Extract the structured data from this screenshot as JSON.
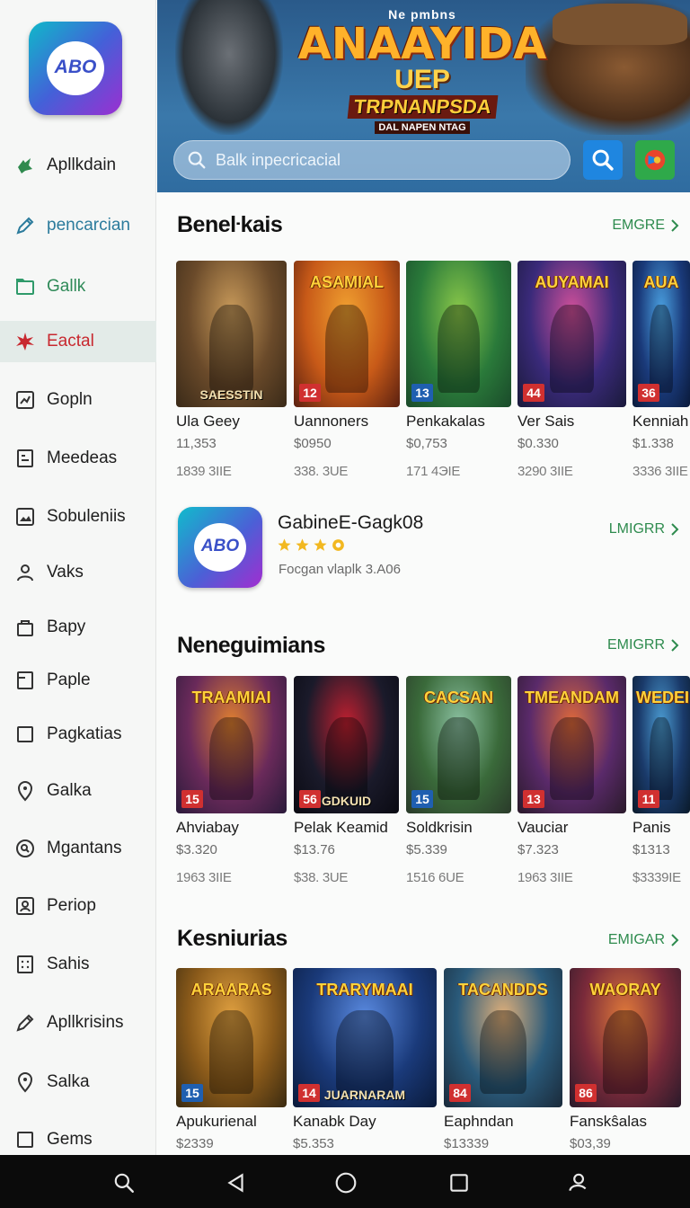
{
  "sidebar": {
    "logo_text": "ABO",
    "items": [
      {
        "label": "Apllkdain",
        "icon": "puzzle-icon",
        "style": "normal",
        "icon_color": "#2f8a4e"
      },
      {
        "label": "pencarcian",
        "icon": "pen-icon",
        "style": "teal",
        "icon_color": "#2b7b9c"
      },
      {
        "label": "Gallk",
        "icon": "folder-icon",
        "style": "green",
        "icon_color": "#2f9a6a"
      },
      {
        "label": "Eactal",
        "icon": "star-burst-icon",
        "style": "active",
        "icon_color": "#c8282f"
      },
      {
        "label": "Gopln",
        "icon": "chart-square-icon",
        "style": "normal",
        "icon_color": "#333333"
      },
      {
        "label": "Meedeas",
        "icon": "grid-doc-icon",
        "style": "normal",
        "icon_color": "#333333"
      },
      {
        "label": "Sobuleniis",
        "icon": "image-icon",
        "style": "normal",
        "icon_color": "#333333"
      },
      {
        "label": "Vaks",
        "icon": "user-icon",
        "style": "normal",
        "icon_color": "#333333"
      },
      {
        "label": "Bapy",
        "icon": "bag-icon",
        "style": "normal",
        "icon_color": "#333333"
      },
      {
        "label": "Paple",
        "icon": "document-icon",
        "style": "normal",
        "icon_color": "#333333"
      },
      {
        "label": "Pagkatias",
        "icon": "square-icon",
        "style": "normal",
        "icon_color": "#333333"
      },
      {
        "label": "Galka",
        "icon": "location-pin-icon",
        "style": "normal",
        "icon_color": "#333333"
      },
      {
        "label": "Mgantans",
        "icon": "search-circle-icon",
        "style": "normal",
        "icon_color": "#333333"
      },
      {
        "label": "Periop",
        "icon": "profile-card-icon",
        "style": "normal",
        "icon_color": "#333333"
      },
      {
        "label": "Sahis",
        "icon": "calculator-icon",
        "style": "normal",
        "icon_color": "#333333"
      },
      {
        "label": "Apllkrisins",
        "icon": "pen-icon",
        "style": "normal",
        "icon_color": "#333333"
      },
      {
        "label": "Salka",
        "icon": "location-pin-icon",
        "style": "normal",
        "icon_color": "#333333"
      },
      {
        "label": "Gems",
        "icon": "square-icon",
        "style": "normal",
        "icon_color": "#333333"
      }
    ]
  },
  "hero": {
    "line0": "Ne pmbns",
    "line1": "ANAAYIDA",
    "line2": "UEP",
    "line3": "TRPNANPSDA",
    "line4": "DAL NAPEN NTAG",
    "search_placeholder": "Balk inpecricacial"
  },
  "sections": [
    {
      "title": "Beneŀkais",
      "more": "EMGRE",
      "cards": [
        {
          "title": "",
          "badge": "",
          "corner": "SAESSTIN",
          "name": "Ula Geey",
          "price": "11,353",
          "size": "1839 3IIE",
          "colors": [
            "#6a4a2a",
            "#c89a5a",
            "#3a2a18"
          ],
          "badge_color": "#c03030"
        },
        {
          "title": "ASAMIAL",
          "badge": "12",
          "corner": "",
          "name": "Uannoners",
          "price": "$0950",
          "size": "338. 3UE",
          "colors": [
            "#c85a18",
            "#f0a030",
            "#5a2010"
          ],
          "badge_color": "#d03030"
        },
        {
          "title": "",
          "badge": "13",
          "corner": "",
          "name": "Penkakalas",
          "price": "$0,753",
          "size": "171 4ЭIE",
          "colors": [
            "#2a7a3a",
            "#8ac84a",
            "#1a4a2a"
          ],
          "badge_color": "#1f5fb0"
        },
        {
          "title": "AUYAMAI",
          "badge": "44",
          "corner": "",
          "name": "Ver Sais",
          "price": "$0.330",
          "size": "3290 3IIE",
          "colors": [
            "#3a2a7a",
            "#d0509a",
            "#1a1a3a"
          ],
          "badge_color": "#d03030"
        },
        {
          "title": "AUA",
          "badge": "36",
          "corner": "",
          "name": "Kenniah",
          "price": "$1.338",
          "size": "3336 3IIE",
          "colors": [
            "#1a3a7a",
            "#4aa0e0",
            "#0a1a3a"
          ],
          "badge_color": "#d03030"
        }
      ]
    },
    {
      "title": "Neneguimians",
      "more": "EMIGRR",
      "cards": [
        {
          "title": "TRAAMIAI",
          "badge": "15",
          "corner": "",
          "name": "Ahviabay",
          "price": "$3.320",
          "size": "1963 3IIE",
          "colors": [
            "#6a2a5a",
            "#e08030",
            "#2a1a3a"
          ],
          "badge_color": "#d03030"
        },
        {
          "title": "",
          "badge": "56",
          "corner": "GDKUID",
          "name": "Pelak Keamid",
          "price": "$13.76",
          "size": "$38. 3UE",
          "colors": [
            "#1a1a2a",
            "#c02030",
            "#0a0a12"
          ],
          "badge_color": "#d03030"
        },
        {
          "title": "CACSAN",
          "badge": "15",
          "corner": "",
          "name": "Soldkrisin",
          "price": "$5.339",
          "size": "1516 6UE",
          "colors": [
            "#3a6a3a",
            "#8ac0a0",
            "#2a3a2a"
          ],
          "badge_color": "#1f5fb0"
        },
        {
          "title": "TMEANDAM",
          "badge": "13",
          "corner": "",
          "name": "Vauciar",
          "price": "$7.323",
          "size": "1963 3IIE",
          "colors": [
            "#5a2a6a",
            "#e06a3a",
            "#2a1a2a"
          ],
          "badge_color": "#d03030"
        },
        {
          "title": "WEDEI",
          "badge": "11",
          "corner": "",
          "name": "Panis",
          "price": "$1313",
          "size": "$3339IE",
          "colors": [
            "#1a3a6a",
            "#4a9ad0",
            "#0a1a2a"
          ],
          "badge_color": "#d03030"
        }
      ]
    },
    {
      "title": "Kesniurias",
      "more": "EMIGAR",
      "cards": [
        {
          "title": "ARAARAS",
          "badge": "15",
          "corner": "",
          "name": "Apukurienal",
          "price": "$2339",
          "size": "",
          "colors": [
            "#8a5a1a",
            "#e0a040",
            "#3a2a10"
          ],
          "badge_color": "#1f5fb0"
        },
        {
          "title": "TRARYMAAI",
          "badge": "14",
          "corner": "JUARNARAM",
          "name": "Kanabk Day",
          "price": "$5.353",
          "size": "",
          "colors": [
            "#1a3a7a",
            "#5a8ae0",
            "#0a1a3a"
          ],
          "badge_color": "#d03030"
        },
        {
          "title": "TACANDDS",
          "badge": "84",
          "corner": "",
          "name": "Eaphndan",
          "price": "$13339",
          "size": "",
          "colors": [
            "#2a5a7a",
            "#e0b07a",
            "#1a2a3a"
          ],
          "badge_color": "#d03030"
        },
        {
          "title": "WAORAY",
          "badge": "86",
          "corner": "",
          "name": "Fanskŝalas",
          "price": "$03,39",
          "size": "",
          "colors": [
            "#7a2a3a",
            "#e07a3a",
            "#2a1a2a"
          ],
          "badge_color": "#d03030"
        }
      ]
    }
  ],
  "featured": {
    "icon_text": "ABO",
    "name": "GabineE-Gagk08",
    "rating": 3.5,
    "subtitle": "Focgan vlaplk 3.A06",
    "more": "LMIGRR"
  },
  "bottom_nav": [
    {
      "icon": "search-icon"
    },
    {
      "icon": "back-triangle-icon"
    },
    {
      "icon": "home-circle-icon"
    },
    {
      "icon": "recents-square-icon"
    },
    {
      "icon": "profile-icon"
    }
  ],
  "colors": {
    "accent_green": "#2e8b4e",
    "hero_blue": "#2f6ca0",
    "active_red": "#c8282f"
  }
}
